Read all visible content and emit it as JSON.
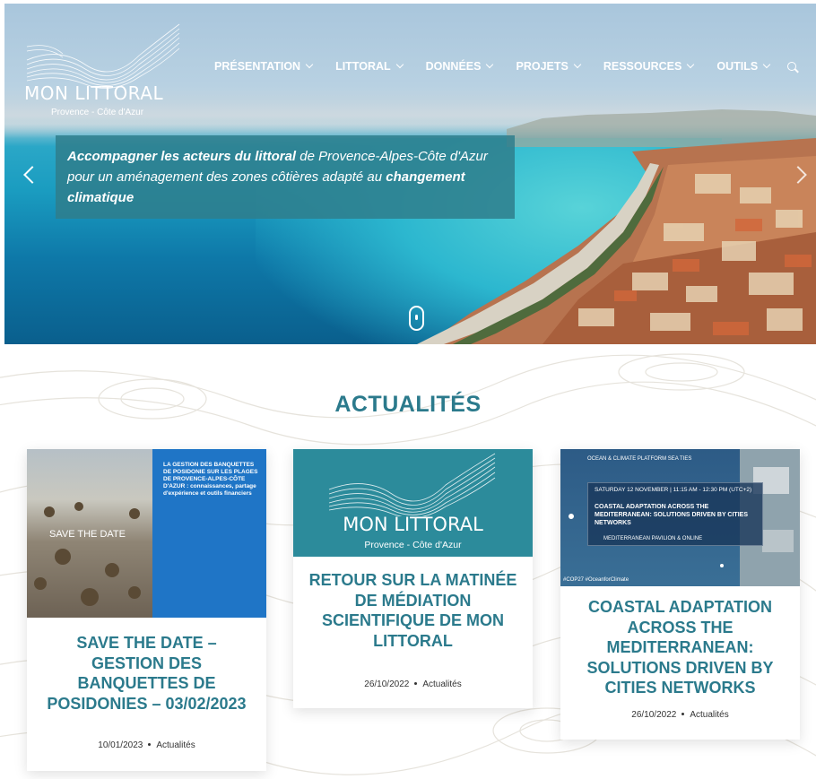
{
  "site": {
    "logo_title": "MON LITTORAL",
    "logo_subtitle": "Provence - Côte d'Azur"
  },
  "nav": {
    "items": [
      {
        "label": "PRÉSENTATION"
      },
      {
        "label": "LITTORAL"
      },
      {
        "label": "DONNÉES"
      },
      {
        "label": "PROJETS"
      },
      {
        "label": "RESSOURCES"
      },
      {
        "label": "OUTILS"
      }
    ]
  },
  "hero": {
    "caption_bold1": "Accompagner les acteurs du littoral",
    "caption_text1": " de Provence-Alpes-Côte d'Azur pour un aménagement des zones côtières adapté au ",
    "caption_bold2": "changement climatique"
  },
  "news": {
    "section_title": "ACTUALITÉS",
    "cards": [
      {
        "title": "SAVE THE DATE – GESTION DES BANQUETTES DE POSIDONIES – 03/02/2023",
        "date": "10/01/2023",
        "category": "Actualités",
        "image_overlay": "SAVE THE DATE",
        "poster_text": "LA GESTION DES BANQUETTES DE POSIDONIE SUR LES PLAGES DE PROVENCE-ALPES-CÔTE D'AZUR : connaissances, partage d'expérience et outils financiers"
      },
      {
        "title": "RETOUR SUR LA MATINÉE DE MÉDIATION SCIENTIFIQUE DE MON LITTORAL",
        "date": "26/10/2022",
        "category": "Actualités",
        "image_title": "MON LITTORAL",
        "image_subtitle": "Provence - Côte d'Azur"
      },
      {
        "title": "COASTAL ADAPTATION ACROSS THE MEDITERRANEAN: SOLUTIONS DRIVEN BY CITIES NETWORKS",
        "date": "26/10/2022",
        "category": "Actualités",
        "image_brand": "OCEAN & CLIMATE PLATFORM   SEA TIES",
        "image_date": "SATURDAY 12 NOVEMBER | 11:15 AM - 12:30 PM (UTC+2)",
        "image_headline": "COASTAL ADAPTATION ACROSS THE MEDITERRANEAN: SOLUTIONS DRIVEN BY CITIES NETWORKS",
        "image_footer": "MEDITERRANEAN PAVILION & ONLINE",
        "image_tags": "#COP27 #OceanforClimate"
      }
    ]
  },
  "colors": {
    "accent": "#2b7a8c",
    "caption_bg": "#2f7e8c",
    "white": "#ffffff"
  }
}
